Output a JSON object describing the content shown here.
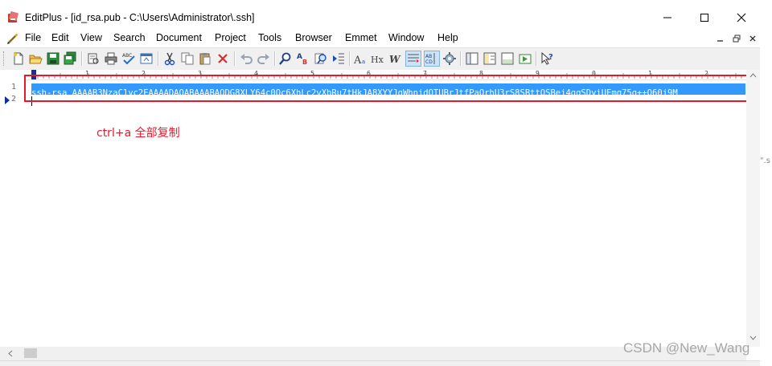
{
  "window": {
    "title": "EditPlus - [id_rsa.pub - C:\\Users\\Administrator\\.ssh]"
  },
  "menu": {
    "items": [
      "File",
      "Edit",
      "View",
      "Search",
      "Document",
      "Project",
      "Tools",
      "Browser",
      "Emmet",
      "Window",
      "Help"
    ]
  },
  "toolbar": {
    "icons": [
      "new-file-icon",
      "open-folder-icon",
      "save-icon",
      "save-all-icon",
      "print-preview-icon",
      "print-icon",
      "spell-check-icon",
      "browser-view-icon",
      "cut-icon",
      "copy-icon",
      "paste-icon",
      "delete-icon",
      "undo-icon",
      "redo-icon",
      "find-icon",
      "replace-icon",
      "find-in-files-icon",
      "goto-line-icon",
      "font-icon",
      "html-toolbar-icon",
      "word-wrap-icon",
      "ruler-toggle-icon",
      "line-numbers-icon",
      "preferences-icon",
      "directory-window-icon",
      "cliptext-icon",
      "output-window-icon",
      "run-icon",
      "help-icon"
    ]
  },
  "editor": {
    "line_numbers": [
      "1",
      "2"
    ],
    "ruler_labels": [
      "1",
      "2",
      "3",
      "4",
      "5",
      "6",
      "7",
      "8",
      "9",
      "0",
      "1",
      "2"
    ],
    "line1": "ssh-rsa AAAAB3NzaC1yc2EAAAADAQABAAABAQDG8XLY64c0Oc6XhLc2vXbRu7tHkJA8XYYJgWhnjdQTUBrJtfPaOrhU3rS8SBttQSBej4gqSDyiUEmq75g++O60j9M",
    "selection_color": "#3399ff"
  },
  "annotation": {
    "text": "ctrl+a 全部复制",
    "color": "#e8182a"
  },
  "background_text": "\".s",
  "watermark": "CSDN @New_Wang"
}
